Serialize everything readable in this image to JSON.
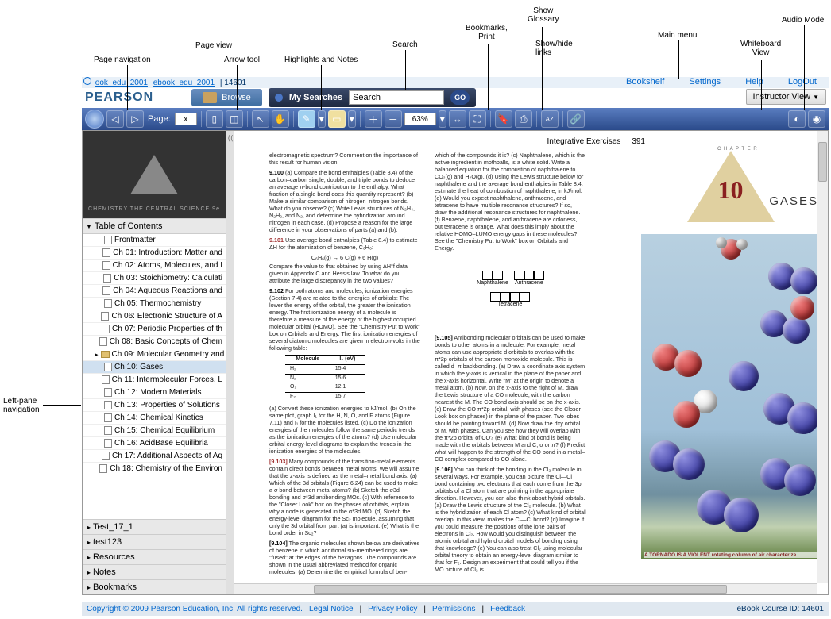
{
  "annotations": {
    "page_navigation": "Page navigation",
    "page_view": "Page view",
    "arrow_tool": "Arrow tool",
    "highlights_notes": "Highlights and Notes",
    "search": "Search",
    "bookmarks_print": "Bookmarks,\nPrint",
    "glossary": "Show\nGlossary",
    "show_hide_links": "Show/hide\nlinks",
    "main_menu": "Main menu",
    "whiteboard": "Whiteboard\nView",
    "audio": "Audio Mode",
    "left_pane": "Left-pane\nnavigation"
  },
  "breadcrumb": {
    "link1": "ook_edu_2001",
    "link2": "ebook_edu_2001",
    "current": "14601"
  },
  "top_links": {
    "bookshelf": "Bookshelf",
    "settings": "Settings",
    "help": "Help",
    "logout": "LogOut"
  },
  "logo": "PEARSON",
  "browse": "Browse",
  "my_searches": "My Searches",
  "search_placeholder": "Search",
  "go": "GO",
  "instructor_view": "Instructor View",
  "toolbar": {
    "page_label": "Page:",
    "page_value": "x",
    "zoom_value": "63%"
  },
  "toc": {
    "header": "Table of Contents",
    "items": [
      {
        "label": "Frontmatter",
        "type": "doc"
      },
      {
        "label": "Ch 01: Introduction: Matter and",
        "type": "doc"
      },
      {
        "label": "Ch 02: Atoms, Molecules, and I",
        "type": "doc"
      },
      {
        "label": "Ch 03: Stoichiometry: Calculati",
        "type": "doc"
      },
      {
        "label": "Ch 04: Aqueous Reactions and",
        "type": "doc"
      },
      {
        "label": "Ch 05: Thermochemistry",
        "type": "doc"
      },
      {
        "label": "Ch 06: Electronic Structure of A",
        "type": "doc"
      },
      {
        "label": "Ch 07: Periodic Properties of th",
        "type": "doc"
      },
      {
        "label": "Ch 08: Basic Concepts of Chem",
        "type": "doc"
      },
      {
        "label": "Ch 09: Molecular Geometry and",
        "type": "folder",
        "expand": true
      },
      {
        "label": "Ch 10: Gases",
        "type": "doc",
        "selected": true
      },
      {
        "label": "Ch 11: Intermolecular Forces, L",
        "type": "doc"
      },
      {
        "label": "Ch 12: Modern Materials",
        "type": "doc"
      },
      {
        "label": "Ch 13: Properties of Solutions",
        "type": "doc"
      },
      {
        "label": "Ch 14: Chemical Kinetics",
        "type": "doc"
      },
      {
        "label": "Ch 15: Chemical Equilibrium",
        "type": "doc"
      },
      {
        "label": "Ch 16: AcidBase Equilibria",
        "type": "doc"
      },
      {
        "label": "Ch 17: Additional Aspects of Aq",
        "type": "doc"
      },
      {
        "label": "Ch 18: Chemistry of the Environ",
        "type": "doc"
      }
    ],
    "sections": [
      "Test_17_1",
      "test123",
      "Resources",
      "Notes",
      "Bookmarks"
    ]
  },
  "thumb_label": "CHEMISTRY THE CENTRAL SCIENCE 9e",
  "page": {
    "running_head": "Integrative Exercises",
    "page_num": "391",
    "col1_intro": "electromagnetic spectrum? Comment on the importance of this result for human vision.",
    "q9100": "(a) Compare the bond enthalpies (Table 8.4) of the carbon–carbon single, double, and triple bonds to deduce an average π-bond contribution to the enthalpy. What fraction of a single bond does this quantity represent? (b) Make a similar comparison of nitrogen–nitrogen bonds. What do you observe? (c) Write Lewis structures of N₂H₄, N₂H₂, and N₂, and determine the hybridization around nitrogen in each case. (d) Propose a reason for the large difference in your observations of parts (a) and (b).",
    "q9101": "Use average bond enthalpies (Table 8.4) to estimate ΔH for the atomization of benzene, C₆H₆:",
    "formula_9101": "C₆H₆(g) → 6 C(g) + 6 H(g)",
    "q9101b": "Compare the value to that obtained by using ΔH°f data given in Appendix C and Hess's law. To what do you attribute the large discrepancy in the two values?",
    "q9102": "For both atoms and molecules, ionization energies (Section 7.4) are related to the energies of orbitals: The lower the energy of the orbital, the greater the ionization energy. The first ionization energy of a molecule is therefore a measure of the energy of the highest occupied molecular orbital (HOMO). See the \"Chemistry Put to Work\" box on Orbitals and Energy. The first ionization energies of several diatomic molecules are given in electron-volts in the following table:",
    "mol_table": {
      "header": [
        "Molecule",
        "I₁ (eV)"
      ],
      "rows": [
        [
          "H₂",
          "15.4"
        ],
        [
          "N₂",
          "15.6"
        ],
        [
          "O₂",
          "12.1"
        ],
        [
          "F₂",
          "15.7"
        ]
      ]
    },
    "q9102b": "(a) Convert these ionization energies to kJ/mol. (b) On the same plot, graph I₁ for the H, N, O, and F atoms (Figure 7.11) and I₁ for the molecules listed. (c) Do the ionization energies of the molecules follow the same periodic trends as the ionization energies of the atoms? (d) Use molecular orbital energy-level diagrams to explain the trends in the ionization energies of the molecules.",
    "q9103": "Many compounds of the transition-metal elements contain direct bonds between metal atoms. We will assume that the z-axis is defined as the metal–metal bond axis. (a) Which of the 3d orbitals (Figure 6.24) can be used to make a σ bond between metal atoms? (b) Sketch the σ3d bonding and σ*3d antibonding MOs. (c) With reference to the \"Closer Look\" box on the phases of orbitals, explain why a node is generated in the σ*3d MO. (d) Sketch the energy-level diagram for the Sc₂ molecule, assuming that only the 3d orbital from part (a) is important. (e) What is the bond order in Sc₂?",
    "q9104": "The organic molecules shown below are derivatives of benzene in which additional six-membered rings are \"fused\" at the edges of the hexagons. The compounds are shown in the usual abbreviated method for organic molecules. (a) Determine the empirical formula of ben-",
    "col2_intro": "which of the compounds it is? (c) Naphthalene, which is the active ingredient in mothballs, is a white solid. Write a balanced equation for the combustion of naphthalene to CO₂(g) and H₂O(g). (d) Using the Lewis structure below for naphthalene and the average bond enthalpies in Table 8.4, estimate the heat of combustion of naphthalene, in kJ/mol. (e) Would you expect naphthalene, anthracene, and tetracene to have multiple resonance structures? If so, draw the additional resonance structures for naphthalene. (f) Benzene, naphthalene, and anthracene are colorless, but tetracene is orange. What does this imply about the relative HOMO–LUMO energy gaps in these molecules? See the \"Chemistry Put to Work\" box on Orbitals and Energy.",
    "labels": {
      "naphthalene": "Naphthalene",
      "anthracene": "Anthracene",
      "tetracene": "Tetracene"
    },
    "q9105": "Antibonding molecular orbitals can be used to make bonds to other atoms in a molecule. For example, metal atoms can use appropriate d orbitals to overlap with the π*2p orbitals of the carbon monoxide molecule. This is called d–π backbonding. (a) Draw a coordinate axis system in which the y-axis is vertical in the plane of the paper and the x-axis horizontal. Write \"M\" at the origin to denote a metal atom. (b) Now, on the x-axis to the right of M, draw the Lewis structure of a CO molecule, with the carbon nearest the M. The CO bond axis should be on the x-axis. (c) Draw the CO π*2p orbital, with phases (see the Closer Look box on phases) in the plane of the paper. Two lobes should be pointing toward M. (d) Now draw the dxy orbital of M, with phases. Can you see how they will overlap with the π*2p orbital of CO? (e) What kind of bond is being made with the orbitals between M and C, σ or π? (f) Predict what will happen to the strength of the CO bond in a metal–CO complex compared to CO alone.",
    "q9106": "You can think of the bonding in the Cl₂ molecule in several ways. For example, you can picture the Cl—Cl bond containing two electrons that each come from the 3p orbitals of a Cl atom that are pointing in the appropriate direction. However, you can also think about hybrid orbitals. (a) Draw the Lewis structure of the Cl₂ molecule. (b) What is the hybridization of each Cl atom? (c) What kind of orbital overlap, in this view, makes the Cl—Cl bond? (d) Imagine if you could measure the positions of the lone pairs of electrons in Cl₂. How would you distinguish between the atomic orbital and hybrid orbital models of bonding using that knowledge? (e) You can also treat Cl₂ using molecular orbital theory to obtain an energy-level diagram similar to that for F₂. Design an experiment that could tell you if the MO picture of Cl₂ is"
  },
  "chapter": {
    "letters": "C  H  A  P  T  E  R",
    "num": "10",
    "title": "GASES",
    "caption": "A TORNADO IS A VIOLENT rotating column of air characterize"
  },
  "footer": {
    "copyright": "Copyright © 2009 Pearson Education, Inc. All rights reserved.",
    "links": [
      "Legal Notice",
      "Privacy Policy",
      "Permissions",
      "Feedback"
    ],
    "course": "eBook Course ID: 14601"
  }
}
